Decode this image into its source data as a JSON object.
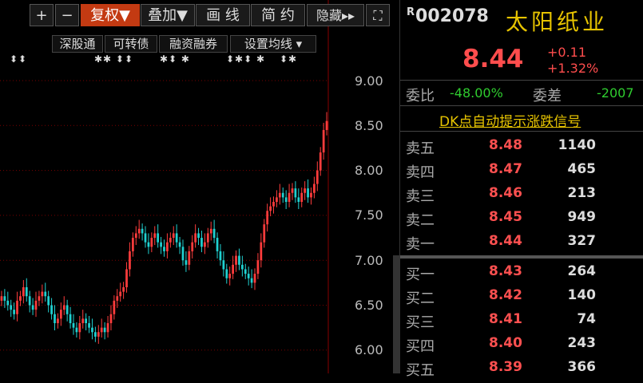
{
  "toolbar": {
    "plus": "+",
    "minus": "−",
    "restore": "复权▼",
    "overlay": "叠加▼",
    "draw": "画 线",
    "simple": "简 约",
    "hide": "隐藏▸▸",
    "fullscreen": "⛶"
  },
  "subtoolbar": {
    "exchange": "深股通",
    "convertible": "可转债",
    "margin": "融资融券",
    "ma_settings": "设置均线 ▾"
  },
  "chart_data": {
    "type": "candlestick",
    "y_ticks": [
      "9.00",
      "8.50",
      "8.00",
      "7.50",
      "7.00",
      "6.50",
      "6.00"
    ],
    "ylim": [
      5.85,
      9.15
    ]
  },
  "quote": {
    "badge": "R",
    "code": "002078",
    "name": "太阳纸业",
    "price": "8.44",
    "change": "+0.11",
    "change_pct": "+1.32%",
    "ratio_label": "委比",
    "ratio_value": "-48.00%",
    "diff_label": "委差",
    "diff_value": "-2007",
    "dk_signal": "DK点自动提示涨跌信号"
  },
  "orderbook": {
    "asks": [
      {
        "label": "卖五",
        "price": "8.48",
        "vol": "1140"
      },
      {
        "label": "卖四",
        "price": "8.47",
        "vol": "465"
      },
      {
        "label": "卖三",
        "price": "8.46",
        "vol": "213"
      },
      {
        "label": "卖二",
        "price": "8.45",
        "vol": "949"
      },
      {
        "label": "卖一",
        "price": "8.44",
        "vol": "327"
      }
    ],
    "bids": [
      {
        "label": "买一",
        "price": "8.43",
        "vol": "264"
      },
      {
        "label": "买二",
        "price": "8.42",
        "vol": "140"
      },
      {
        "label": "买三",
        "price": "8.41",
        "vol": "74"
      },
      {
        "label": "买四",
        "price": "8.40",
        "vol": "243"
      },
      {
        "label": "买五",
        "price": "8.39",
        "vol": "366"
      }
    ]
  },
  "colors": {
    "up": "#ff3c3c",
    "down": "#1fd1d1",
    "accent": "#c33a12",
    "gold": "#e6c300"
  }
}
